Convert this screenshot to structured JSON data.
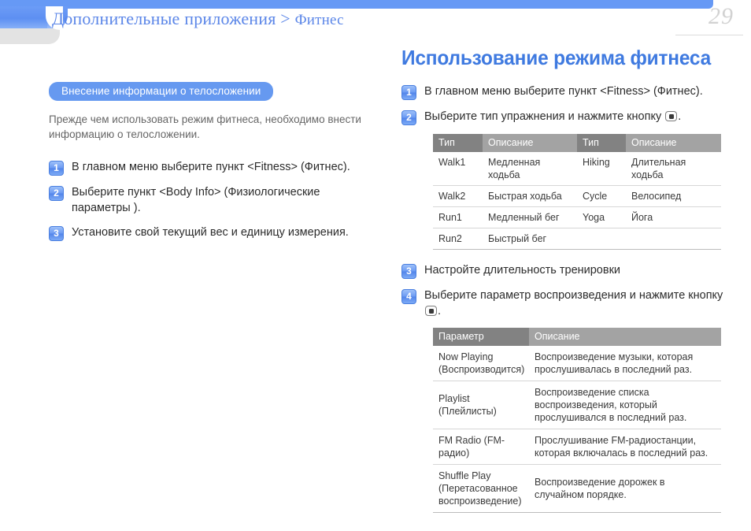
{
  "header": {
    "breadcrumb_parent": "Дополнительные приложения",
    "breadcrumb_separator": ">",
    "breadcrumb_leaf": "Фитнес",
    "page_number": "29",
    "accent_color": "#6699f5",
    "title_color": "#3f7ae0"
  },
  "left": {
    "section_badge": "Внесение информации о телосложении",
    "intro": "Прежде чем использовать режим фитнеса, необходимо внести информацию о телосложении.",
    "steps": [
      {
        "num": "1",
        "text": "В главном меню выберите пункт <Fitness> (Фитнес)."
      },
      {
        "num": "2",
        "text": "Выберите пункт <Body Info> (Физиологические параметры )."
      },
      {
        "num": "3",
        "text": "Установите свой текущий вес и единицу измерения."
      }
    ]
  },
  "right": {
    "title": "Использование режима фитнеса",
    "steps": [
      {
        "num": "1",
        "text": "В главном меню выберите пункт <Fitness> (Фитнес)."
      },
      {
        "num": "2",
        "text_before": "Выберите тип упражнения и нажмите кнопку ",
        "icon": "ok-button-icon",
        "text_after": "."
      },
      {
        "num": "3",
        "text": "Настройте длительность тренировки"
      },
      {
        "num": "4",
        "text_before": "Выберите параметр воспроизведения и нажмите кнопку ",
        "icon": "ok-button-icon",
        "text_after": "."
      }
    ],
    "table_types": {
      "headers": [
        "Тип",
        "Описание",
        "Тип",
        "Описание"
      ],
      "rows": [
        [
          "Walk1",
          "Медленная ходьба",
          "Hiking",
          "Длительная ходьба"
        ],
        [
          "Walk2",
          "Быстрая ходьба",
          "Cycle",
          "Велосипед"
        ],
        [
          "Run1",
          "Медленный бег",
          "Yoga",
          "Йога"
        ],
        [
          "Run2",
          "Быстрый бег",
          "",
          ""
        ]
      ]
    },
    "table_play": {
      "headers": [
        "Параметр",
        "Описание"
      ],
      "rows": [
        [
          "Now Playing (Воспроизводится)",
          "Воспроизведение музыки, которая прослушивалась в последний раз."
        ],
        [
          "Playlist (Плейлисты)",
          "Воспроизведение списка воспроизведения, который прослушивался в последний раз."
        ],
        [
          "FM Radio (FM-радио)",
          "Прослушивание FM-радиостанции, которая включалась в последний раз."
        ],
        [
          "Shuffle Play (Перетасованное воспроизведение)",
          "Воспроизведение дорожек в случайном порядке."
        ]
      ]
    }
  }
}
